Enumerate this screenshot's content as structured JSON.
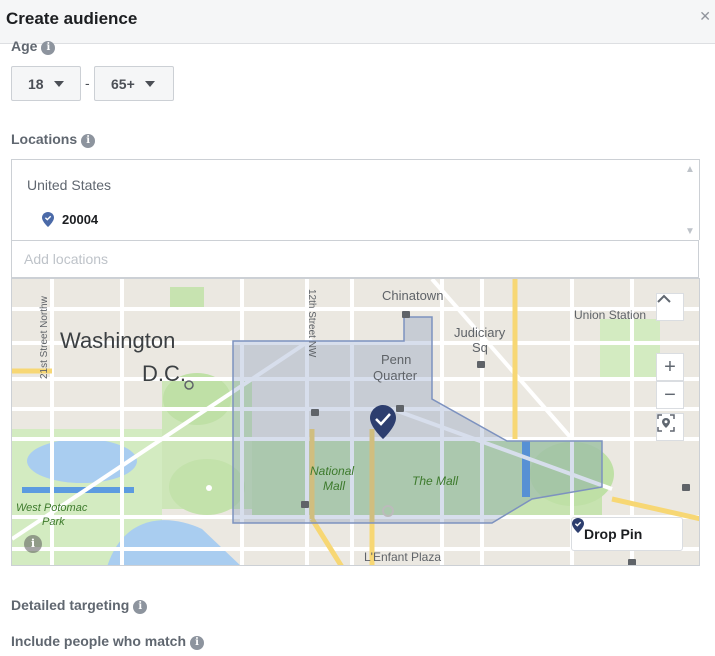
{
  "header": {
    "title": "Create audience",
    "close_glyph": "✕"
  },
  "age": {
    "label": "Age",
    "min": "18",
    "max": "65+",
    "separator": "-"
  },
  "locations": {
    "label": "Locations",
    "country": "United States",
    "items": [
      {
        "name": "20004",
        "icon": "location-pin-icon"
      }
    ],
    "add_placeholder": "Add locations"
  },
  "map": {
    "labels": {
      "chinatown": "Chinatown",
      "washington_l1": "Washington",
      "washington_l2": "D.C.",
      "judiciary_l1": "Judiciary",
      "judiciary_l2": "Sq",
      "penn_l1": "Penn",
      "penn_l2": "Quarter",
      "union": "Union Station",
      "street_12": "12th Street NW",
      "street_21": "21st Street Northw",
      "mall_l1": "National",
      "mall_l2": "Mall",
      "the_mall": "The Mall",
      "potomac_l1": "West Potomac",
      "potomac_l2": "Park",
      "lenfant": "L'Enfant Plaza"
    },
    "controls": {
      "collapse": "^",
      "zoom_in": "+",
      "zoom_out": "−",
      "drop_pin": "Drop Pin"
    },
    "colors": {
      "background": "#ebe8e1",
      "park": "#cde6b8",
      "water": "#a9cdf0",
      "highlight": "#4b6aa8",
      "pin": "#2d3e6e",
      "yellow_road": "#f7d774"
    }
  },
  "detailed_targeting": {
    "label": "Detailed targeting"
  },
  "include": {
    "label": "Include people who match"
  }
}
